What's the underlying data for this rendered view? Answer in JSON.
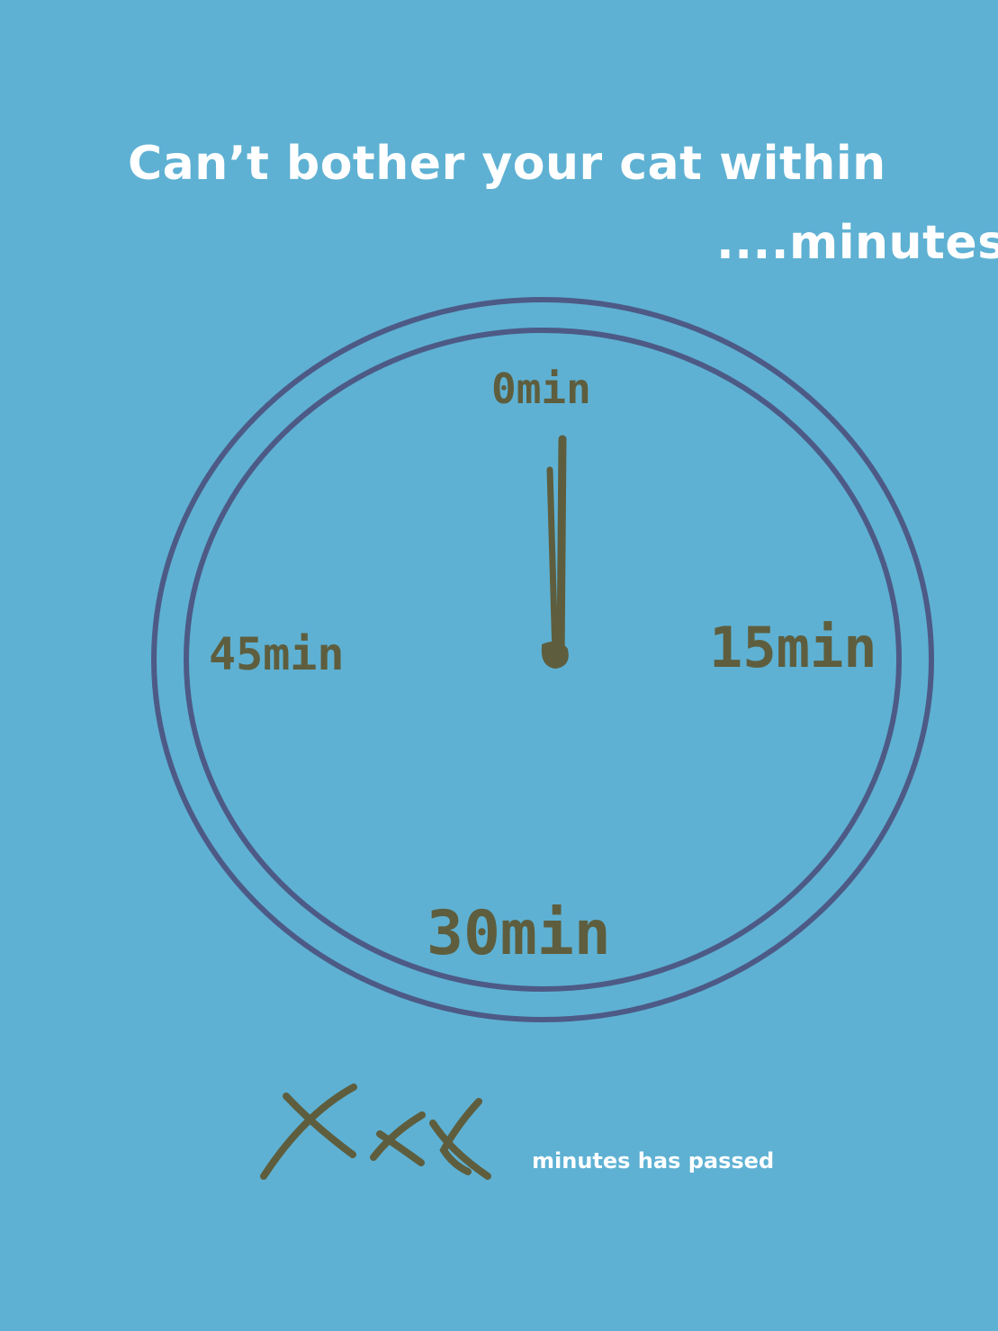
{
  "title": {
    "line1": "Can’t bother your cat within",
    "line2": "....minutes"
  },
  "clock": {
    "labels": {
      "top": "0min",
      "right": "15min",
      "bottom": "30min",
      "left": "45min"
    },
    "colors": {
      "ring": "#4d5a86",
      "ink": "#5e5e3e"
    }
  },
  "counter": {
    "marks": "XXX",
    "caption": "minutes has passed"
  },
  "colors": {
    "background": "#5eb1d3",
    "title_text": "#ffffff"
  }
}
